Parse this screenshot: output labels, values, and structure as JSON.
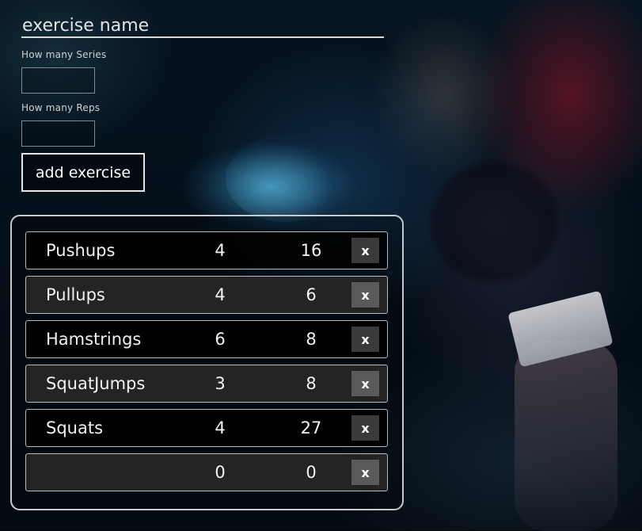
{
  "form": {
    "name_placeholder": "exercise name",
    "series_label": "How many Series",
    "reps_label": "How many Reps",
    "series_value": "",
    "reps_value": "",
    "add_button_label": "add exercise"
  },
  "exercises": [
    {
      "name": "Pushups",
      "series": "4",
      "reps": "16",
      "delete_label": "x"
    },
    {
      "name": "Pullups",
      "series": "4",
      "reps": "6",
      "delete_label": "x"
    },
    {
      "name": "Hamstrings",
      "series": "6",
      "reps": "8",
      "delete_label": "x"
    },
    {
      "name": "SquatJumps",
      "series": "3",
      "reps": "8",
      "delete_label": "x"
    },
    {
      "name": "Squats",
      "series": "4",
      "reps": "27",
      "delete_label": "x"
    },
    {
      "name": "",
      "series": "0",
      "reps": "0",
      "delete_label": "x"
    }
  ],
  "colors": {
    "row_dark": "#000000",
    "row_light": "#262628",
    "text": "#f2f2f2",
    "border": "#c8c8c8"
  }
}
